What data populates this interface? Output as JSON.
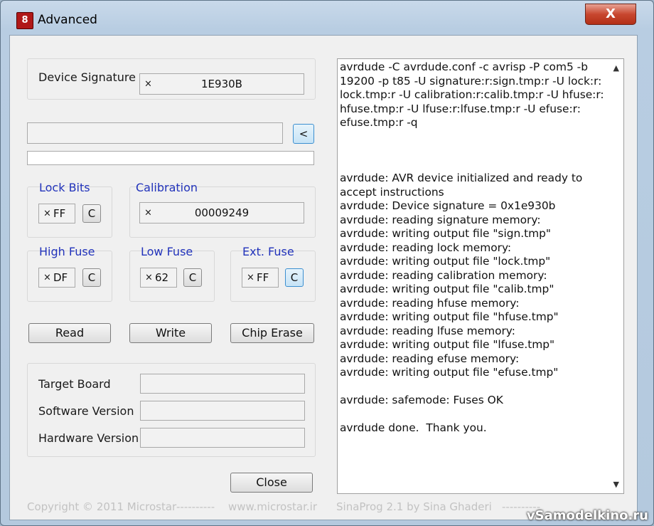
{
  "window": {
    "title": "Advanced",
    "close_glyph": "X",
    "app_icon_glyph": "8"
  },
  "device_signature": {
    "label": "Device Signature",
    "x": "×",
    "value": "1E930B"
  },
  "hex_input": {
    "value": "",
    "arrow_label": "<"
  },
  "lock_bits": {
    "label": "Lock Bits",
    "x": "×",
    "value": "FF",
    "button": "C"
  },
  "calibration": {
    "label": "Calibration",
    "x": "×",
    "value": "00009249"
  },
  "high_fuse": {
    "label": "High Fuse",
    "x": "×",
    "value": "DF",
    "button": "C"
  },
  "low_fuse": {
    "label": "Low Fuse",
    "x": "×",
    "value": "62",
    "button": "C"
  },
  "ext_fuse": {
    "label": "Ext. Fuse",
    "x": "×",
    "value": "FF",
    "button": "C"
  },
  "actions": {
    "read": "Read",
    "write": "Write",
    "chip_erase": "Chip Erase",
    "close": "Close"
  },
  "info": {
    "target_board": "Target Board",
    "software_version": "Software Version",
    "hardware_version": "Hardware Version"
  },
  "log_text": "avrdude -C avrdude.conf -c avrisp -P com5 -b\n19200 -p t85 -U signature:r:sign.tmp:r -U lock:r:\nlock.tmp:r -U calibration:r:calib.tmp:r -U hfuse:r:\nhfuse.tmp:r -U lfuse:r:lfuse.tmp:r -U efuse:r:\nefuse.tmp:r -q\n\n\n\navrdude: AVR device initialized and ready to\naccept instructions\navrdude: Device signature = 0x1e930b\navrdude: reading signature memory:\navrdude: writing output file \"sign.tmp\"\navrdude: reading lock memory:\navrdude: writing output file \"lock.tmp\"\navrdude: reading calibration memory:\navrdude: writing output file \"calib.tmp\"\navrdude: reading hfuse memory:\navrdude: writing output file \"hfuse.tmp\"\navrdude: reading lfuse memory:\navrdude: writing output file \"lfuse.tmp\"\navrdude: reading efuse memory:\navrdude: writing output file \"efuse.tmp\"\n\navrdude: safemode: Fuses OK\n\navrdude done.  Thank you.",
  "scroll": {
    "up": "▲",
    "down": "▼"
  },
  "footer": {
    "copyright": "Copyright © 2011 Microstar",
    "dashes": "----------",
    "url": "www.microstar.ir",
    "credit": "SinaProg 2.1  by  Sina Ghaderi",
    "tail": "----------"
  },
  "watermark": "vSamodelkino.ru",
  "colors": {
    "accent_label": "#2233bb",
    "close_red": "#c8472f"
  }
}
